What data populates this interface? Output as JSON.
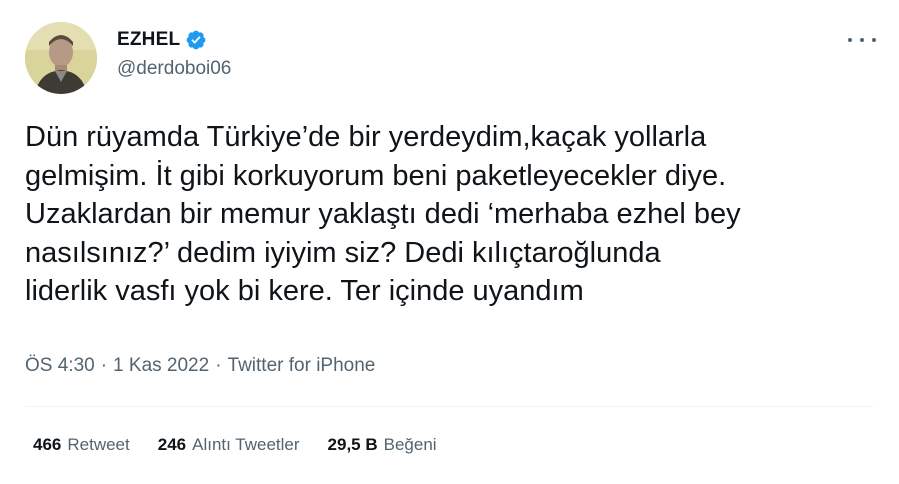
{
  "tweet": {
    "author": {
      "display_name": "EZHEL",
      "handle": "@derdoboi06",
      "verified": true,
      "verified_color": "#1d9bf0"
    },
    "text": "Dün rüyamda Türkiye’de bir yerdeydim,kaçak yollarla\ngelmişim. İt gibi korkuyorum beni paketleyecekler diye.\nUzaklardan bir memur yaklaştı dedi ‘merhaba ezhel bey\nnasılsınız?’ dedim iyiyim siz? Dedi kılıçtaroğlunda\nliderlik vasfı yok bi kere. Ter içinde uyandım",
    "meta": {
      "time": "ÖS 4:30",
      "separator": "·",
      "date": "1 Kas 2022",
      "source": "Twitter for iPhone"
    },
    "stats": {
      "retweets": {
        "count": "466",
        "label": "Retweet"
      },
      "quotes": {
        "count": "246",
        "label": "Alıntı Tweetler"
      },
      "likes": {
        "count": "29,5 B",
        "label": "Beğeni"
      }
    }
  },
  "icons": {
    "more": "more-horizontal-icon",
    "verified": "verified-badge-icon"
  },
  "colors": {
    "text_primary": "#0f1419",
    "text_secondary": "#536471",
    "divider": "#eff3f4",
    "accent": "#1d9bf0"
  }
}
